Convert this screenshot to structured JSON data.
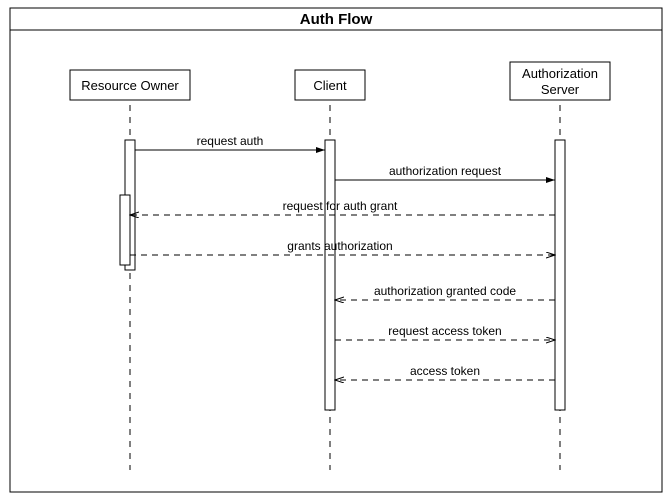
{
  "title": "Auth Flow",
  "actors": {
    "a0": "Resource Owner",
    "a1": "Client",
    "a2_line1": "Authorization",
    "a2_line2": "Server"
  },
  "messages": {
    "m0": "request auth",
    "m1": "authorization request",
    "m2": "request for auth grant",
    "m3": "grants authorization",
    "m4": "authorization granted code",
    "m5": "request access token",
    "m6": "access token"
  }
}
